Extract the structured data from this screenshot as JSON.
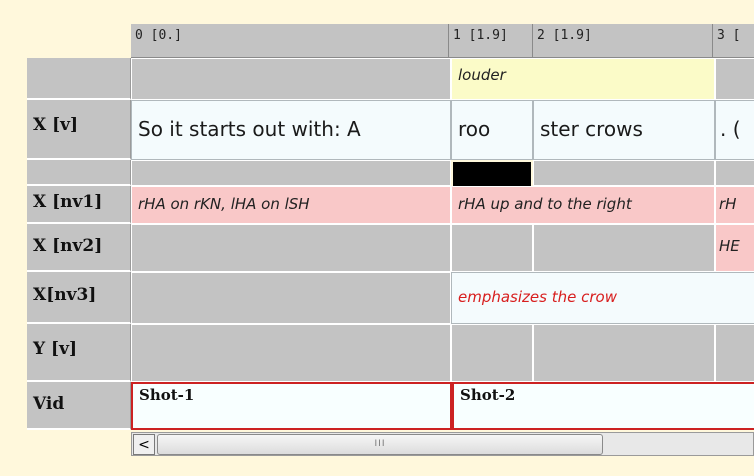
{
  "ruler": {
    "ticks": [
      "0 [0.]",
      "1 [1.9]",
      "2 [1.9]",
      "3 ["
    ]
  },
  "tiers": [
    {
      "label": ""
    },
    {
      "label": "X [v]"
    },
    {
      "label": ""
    },
    {
      "label": "X [nv1]"
    },
    {
      "label": "X [nv2]"
    },
    {
      "label": "X[nv3]"
    },
    {
      "label": "Y [v]"
    },
    {
      "label": "Vid"
    }
  ],
  "annotations": {
    "louder": "louder",
    "utterance_1": "So it starts out with: A",
    "utterance_2": "roo",
    "utterance_3": "ster crows",
    "utterance_4": ". (",
    "nv1_1": "rHA on rKN, lHA on lSH",
    "nv1_2": "rHA up and to the right",
    "nv1_3": "rH",
    "nv2_1": "HE",
    "nv3_1": "emphasizes the crow"
  },
  "video": {
    "shot_1": "Shot-1",
    "shot_2": "Shot-2"
  },
  "scrollbar": {
    "left_arrow": "<",
    "thumb_grip": "III"
  },
  "colors": {
    "background": "#fff8dc",
    "tier_gray": "#c3c3c3",
    "pink": "#f9c8c8",
    "yellow": "#fbfbc8",
    "vid_border": "#cc2222",
    "emphasis_text": "#d81e1e"
  }
}
